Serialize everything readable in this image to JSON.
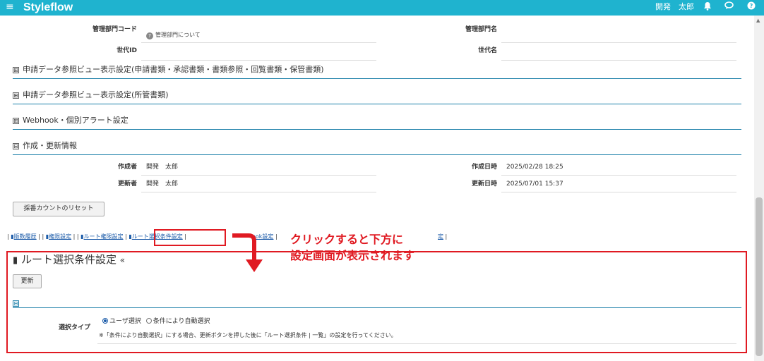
{
  "header": {
    "menu_icon": "hamburger-icon",
    "brand": "Styleflow",
    "user_name": "開発　太郎",
    "icons": [
      "bell-icon",
      "chat-icon",
      "help-icon"
    ]
  },
  "form": {
    "dept_code_label": "管理部門コード",
    "dept_help_text": "管理部門について",
    "dept_name_label": "管理部門名",
    "generation_id_label": "世代ID",
    "generation_name_label": "世代名"
  },
  "sections": [
    {
      "label": "申請データ参照ビュー表示設定(申請書類・承認書類・書類参照・回覧書類・保管書類)",
      "toggle": "⊞"
    },
    {
      "label": "申請データ参照ビュー表示設定(所管書類)",
      "toggle": "⊞"
    },
    {
      "label": "Webhook・個別アラート設定",
      "toggle": "⊞"
    },
    {
      "label": "作成・更新情報",
      "toggle": "⊟"
    }
  ],
  "info": {
    "creator_label": "作成者",
    "creator_value": "開発　太郎",
    "created_at_label": "作成日時",
    "created_at_value": "2025/02/28 18:25",
    "updater_label": "更新者",
    "updater_value": "開発　太郎",
    "updated_at_label": "更新日時",
    "updated_at_value": "2025/07/01 15:37"
  },
  "reset_button": "採番カウントのリセット",
  "tabs": {
    "version_history": "版数履歴",
    "permission": "権限設定",
    "route_permission": "ルート権限設定",
    "route_condition": "ルート選択条件設定",
    "webhook_partial": "ook設定",
    "last_partial": "定"
  },
  "callout": {
    "line1": "クリックすると下方に",
    "line2": "設定画面が表示されます"
  },
  "route_panel": {
    "title": "ルート選択条件設定",
    "collapse_icon": "«",
    "update_button": "更新",
    "toggle": "⊟",
    "select_type_label": "選択タイプ",
    "option_user": "ユーザ選択",
    "option_auto": "条件により自動選択",
    "note": "※「条件により自動選択」にする場合、更新ボタンを押した後に「ルート選択条件 | 一覧」の設定を行ってください。"
  }
}
